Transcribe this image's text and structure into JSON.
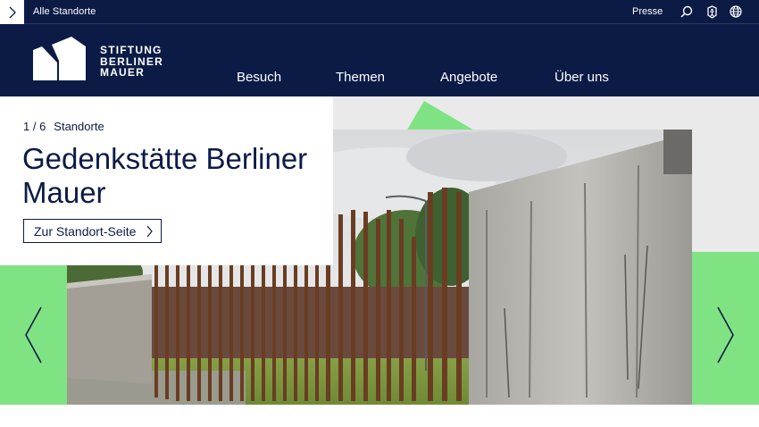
{
  "topbar": {
    "menu_toggle_icon": "chevron-right-icon",
    "locations_link": "Alle Standorte",
    "press_link": "Presse",
    "icons": [
      "search-icon",
      "accessibility-icon",
      "language-globe-icon"
    ]
  },
  "header": {
    "logo_lines": [
      "STIFTUNG",
      "BERLINER",
      "MAUER"
    ],
    "nav": [
      "Besuch",
      "Themen",
      "Angebote",
      "Über uns"
    ]
  },
  "hero": {
    "slide_index": "1 / 6",
    "category": "Standorte",
    "title": "Gedenkstätte Berliner Mauer",
    "cta_label": "Zur Standort-Seite",
    "prev_icon": "chevron-left-icon",
    "next_icon": "chevron-right-icon"
  },
  "colors": {
    "navy": "#0b1b46",
    "accent_green": "#7fe383",
    "background_gray": "#eaeaea"
  }
}
